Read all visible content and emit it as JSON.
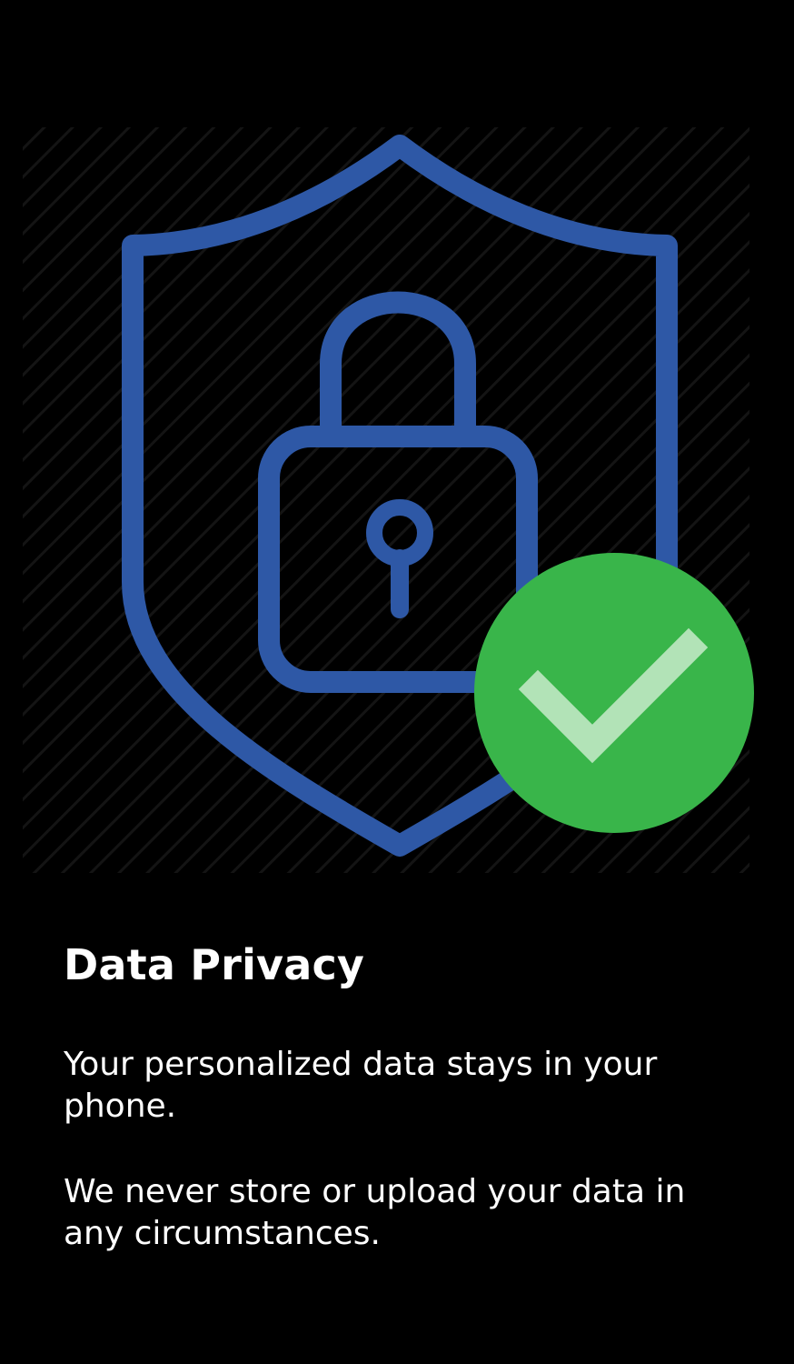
{
  "screen": {
    "title": "Data Privacy",
    "paragraphs": [
      "Your personalized data stays in your phone.",
      "We never store or upload your data in any circumstances."
    ]
  },
  "illustration": {
    "icons": [
      "shield-icon",
      "padlock-icon",
      "keyhole-icon",
      "check-circle-icon"
    ],
    "colors": {
      "shield": "#2e58a6",
      "check_circle": "#39b54a",
      "check_mark": "#b2e3b7",
      "background": "#000000"
    }
  }
}
